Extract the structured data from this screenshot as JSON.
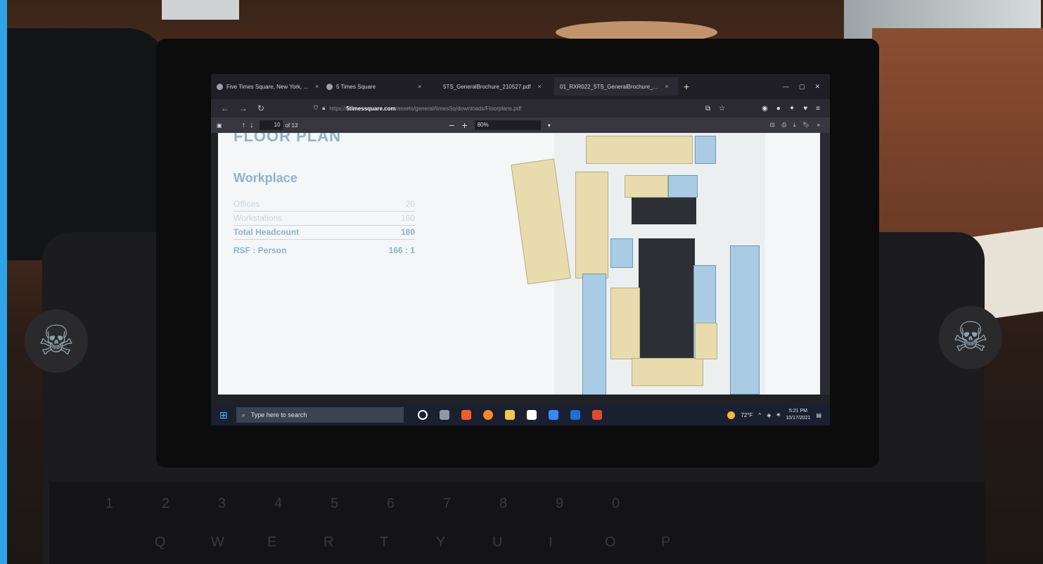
{
  "browser": {
    "tabs": [
      {
        "label": "Five Times Square, New York, ..."
      },
      {
        "label": "5 Times Square"
      },
      {
        "label": "5TS_GeneralBrochure_210527.pdf"
      },
      {
        "label": "01_RXR022_5TS_GeneralBrochure_..."
      }
    ],
    "new_tab": "+",
    "url_host": "5timessquare.com",
    "url_prefix": "https://",
    "url_path": "/assets/general/timesSq/downloads/Floorplans.pdf"
  },
  "pdf_toolbar": {
    "page_current": "10",
    "page_total": "of 13",
    "zoom": "80%",
    "zoom_out": "−",
    "zoom_in": "+"
  },
  "document": {
    "heading": "FLOOR PLAN",
    "section": "Workplace",
    "stats": [
      {
        "label": "Offices",
        "value": "20"
      },
      {
        "label": "Workstations",
        "value": "160"
      },
      {
        "label": "Total Headcount",
        "value": "180"
      }
    ],
    "ratio_label": "RSF : Person",
    "ratio_value": "166 : 1"
  },
  "taskbar": {
    "search_placeholder": "Type here to search",
    "weather": "72°F",
    "time": "5:21 PM",
    "date": "10/17/2021"
  },
  "colors": {
    "screen_blue_edge": "#2fa3e8",
    "doc_accent": "#8fb3c8"
  }
}
